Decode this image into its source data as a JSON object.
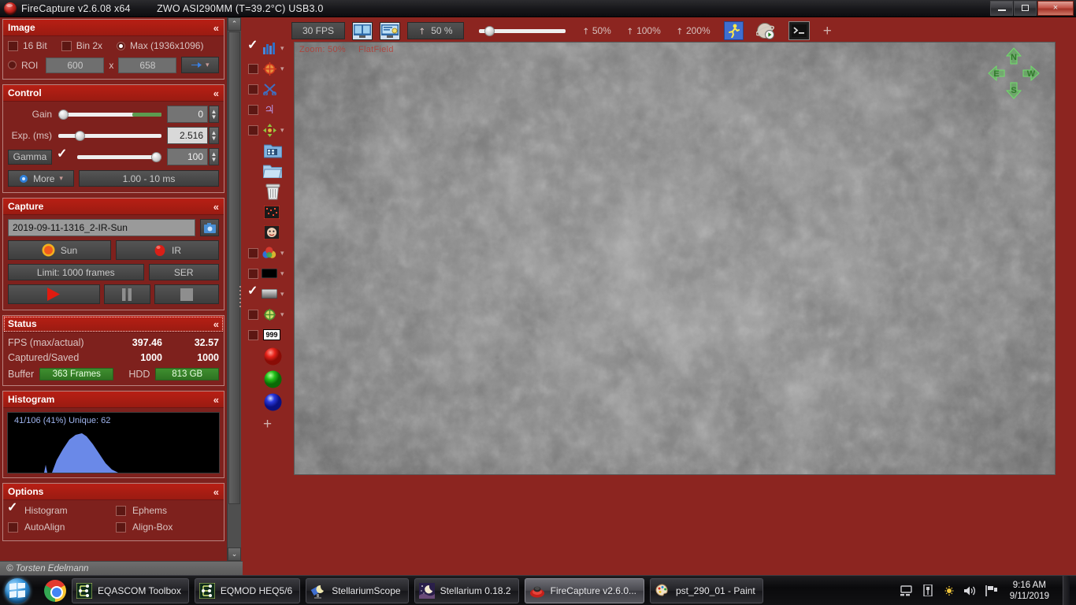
{
  "window": {
    "app_icon": "firecapture-icon",
    "title_app": "FireCapture v2.6.08  x64",
    "title_camera": "ZWO ASI290MM (T=39.2°C) USB3.0",
    "minimize_label": "minimize",
    "maximize_label": "restore",
    "close_label": "×"
  },
  "sidebar": {
    "image": {
      "title": "Image",
      "collapse_glyph": "«",
      "bit16_label": "16 Bit",
      "bit16_checked": false,
      "bin2x_label": "Bin 2x",
      "bin2x_checked": false,
      "max_label": "Max (1936x1096)",
      "max_selected": true,
      "roi_label": "ROI",
      "roi_selected": false,
      "roi_width": "600",
      "roi_x": "x",
      "roi_height": "658",
      "roi_apply_icon": "blue-arrow-icon"
    },
    "control": {
      "title": "Control",
      "collapse_glyph": "«",
      "gain_label": "Gain",
      "gain_value": "0",
      "gain_pct": 3,
      "gain_fill_pct": 72,
      "exp_label": "Exp. (ms)",
      "exp_value": "2.516",
      "exp_pct": 16,
      "gamma_label": "Gamma",
      "gamma_checked": true,
      "gamma_value": "100",
      "gamma_pct": 96,
      "more_label": "More",
      "more_icon": "settings-gear-icon",
      "range_label": "1.00 - 10 ms"
    },
    "capture": {
      "title": "Capture",
      "collapse_glyph": "«",
      "filename": "2019-09-11-1316_2-IR-Sun",
      "settings_icon": "camera-settings-icon",
      "sun_label": "Sun",
      "sun_icon": "sun-icon",
      "ir_label": "IR",
      "ir_icon": "ir-filter-icon",
      "limit_label": "Limit: 1000 frames",
      "format_label": "SER",
      "record_icon": "play-record-icon",
      "pause_icon": "pause-icon",
      "stop_icon": "stop-icon"
    },
    "status": {
      "title": "Status",
      "collapse_glyph": "«",
      "rows": [
        {
          "label": "FPS (max/actual)",
          "v1": "397.46",
          "v2": "32.57"
        },
        {
          "label": "Captured/Saved",
          "v1": "1000",
          "v2": "1000"
        }
      ],
      "buffer_label": "Buffer",
      "buffer_value": "363 Frames",
      "hdd_label": "HDD",
      "hdd_value": "813 GB"
    },
    "histogram": {
      "title": "Histogram",
      "collapse_glyph": "«",
      "readout": "41/106 (41%)  Unique: 62",
      "peak_color": "#6a89e8"
    },
    "options": {
      "title": "Options",
      "collapse_glyph": "«",
      "items": [
        {
          "label": "Histogram",
          "checked": true
        },
        {
          "label": "Ephems",
          "checked": false
        },
        {
          "label": "AutoAlign",
          "checked": false
        },
        {
          "label": "Align-Box",
          "checked": false
        }
      ]
    },
    "footer_credit": "© Torsten Edelmann",
    "scroll_up_glyph": "⌃",
    "scroll_down_glyph": "⌄"
  },
  "tool_strip": {
    "items": [
      {
        "name": "histogram-toggle",
        "icon": "bar-chart-icon",
        "checked": true,
        "has_caret": true
      },
      {
        "name": "crosshair-toggle",
        "icon": "target-crosshair-icon",
        "checked": false,
        "has_caret": true
      },
      {
        "name": "scissors-toggle",
        "icon": "scissors-icon",
        "checked": false,
        "has_caret": false
      },
      {
        "name": "jupiter-toggle",
        "icon": "jupiter-symbol-icon",
        "checked": false,
        "has_caret": false
      },
      {
        "name": "align-toggle",
        "icon": "move-arrows-icon",
        "checked": false,
        "has_caret": true
      },
      {
        "name": "open-film",
        "icon": "film-folder-icon",
        "checked": null,
        "has_caret": false
      },
      {
        "name": "open-folder",
        "icon": "folder-icon",
        "checked": null,
        "has_caret": false
      },
      {
        "name": "delete",
        "icon": "trash-icon",
        "checked": null,
        "has_caret": false
      },
      {
        "name": "noise-pattern",
        "icon": "dark-frame-icon",
        "checked": null,
        "has_caret": false
      },
      {
        "name": "face-monitor",
        "icon": "face-icon",
        "checked": null,
        "has_caret": false
      },
      {
        "name": "color-toggle",
        "icon": "color-balls-icon",
        "checked": false,
        "has_caret": true
      },
      {
        "name": "black-toggle",
        "icon": "black-bar-icon",
        "checked": false,
        "has_caret": true
      },
      {
        "name": "gradient-toggle",
        "icon": "gradient-bar-icon",
        "checked": true,
        "has_caret": true
      },
      {
        "name": "green-target-toggle",
        "icon": "green-target-icon",
        "checked": false,
        "has_caret": true
      },
      {
        "name": "counter-toggle",
        "icon": "counter-999-icon",
        "checked": false,
        "has_caret": false
      },
      {
        "name": "red-channel",
        "icon": "red-ball-icon",
        "checked": null,
        "has_caret": false
      },
      {
        "name": "green-channel",
        "icon": "green-ball-icon",
        "checked": null,
        "has_caret": false
      },
      {
        "name": "blue-channel",
        "icon": "blue-ball-icon",
        "checked": null,
        "has_caret": false
      },
      {
        "name": "add-tool",
        "icon": "plus-icon",
        "checked": null,
        "has_caret": false
      }
    ],
    "counter_text": "999",
    "plus_glyph": "+"
  },
  "toolbar": {
    "fps_label": "30 FPS",
    "dual_view_icon": "dual-monitor-icon",
    "screen_icon": "screen-capture-icon",
    "zoom_label": "50 %",
    "zoom_slider_pct": 10,
    "zoom_50": "50%",
    "zoom_100": "100%",
    "zoom_200": "200%",
    "runner_icon": "runner-icon",
    "planet_icon": "planet-play-icon",
    "console_icon": "terminal-icon",
    "plus_label": "+"
  },
  "preview": {
    "overlay_zoom": "Zoom: 50%",
    "overlay_flat": "FlatField",
    "compass": {
      "n": "N",
      "e": "E",
      "w": "W",
      "s": "S",
      "color": "#5fbf5a"
    }
  },
  "taskbar": {
    "start_icon": "windows-start-icon",
    "chrome_icon": "chrome-icon",
    "items": [
      {
        "label": "EQASCOM Toolbox",
        "icon": "eqascom-icon",
        "active": false
      },
      {
        "label": "EQMOD HEQ5/6",
        "icon": "eqmod-icon",
        "active": false
      },
      {
        "label": "StellariumScope",
        "icon": "stellariumscope-icon",
        "active": false
      },
      {
        "label": "Stellarium 0.18.2",
        "icon": "stellarium-icon",
        "active": false
      },
      {
        "label": "FireCapture v2.6.0...",
        "icon": "firecapture-icon",
        "active": true
      },
      {
        "label": "pst_290_01 - Paint",
        "icon": "paint-icon",
        "active": false
      }
    ],
    "tray": [
      {
        "name": "network-tray-icon"
      },
      {
        "name": "device-tray-icon"
      },
      {
        "name": "brightness-tray-icon"
      },
      {
        "name": "volume-tray-icon"
      },
      {
        "name": "action-center-tray-icon"
      }
    ],
    "time": "9:16 AM",
    "date": "9/11/2019"
  }
}
